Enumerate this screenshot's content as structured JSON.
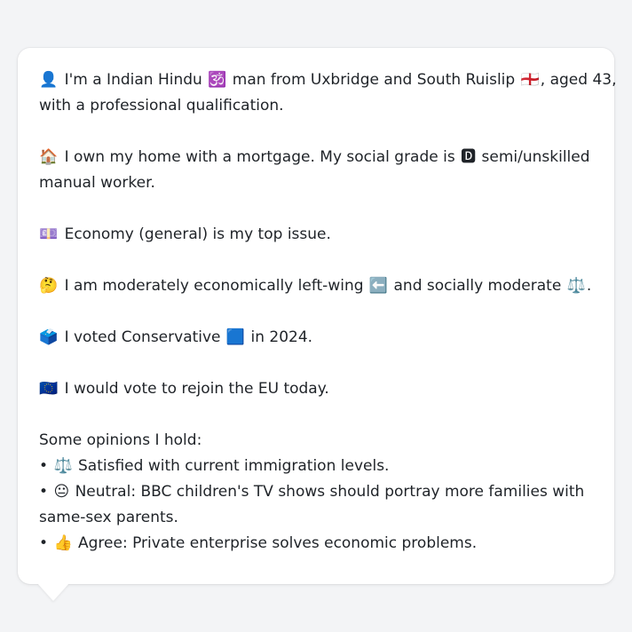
{
  "profile": {
    "identity": {
      "icon": "👤",
      "line1_a": "I'm a Indian Hindu",
      "hindu_icon": "🕉️",
      "line1_b": "man from Uxbridge and South Ruislip",
      "flag_icon": "🏴󠁧󠁢󠁥󠁮󠁧󠁿",
      "line1_c": ", aged 43,",
      "line2": "with a professional qualification."
    },
    "home": {
      "icon": "🏠",
      "line1_a": "I own my home with a mortgage. My social grade is",
      "grade_icon": "🅳",
      "line1_b": "semi/unskilled",
      "line2": "manual worker."
    },
    "issue": {
      "icon": "💷",
      "text": "Economy (general) is my top issue."
    },
    "ideology": {
      "icon": "🤔",
      "text_a": "I am moderately economically left-wing",
      "left_icon": "⬅️",
      "text_b": "and socially moderate",
      "scale_icon": "⚖️",
      "text_c": "."
    },
    "vote": {
      "icon": "🗳️",
      "text_a": "I voted Conservative",
      "party_icon": "🟦",
      "text_b": "in 2024."
    },
    "eu": {
      "icon": "🇪🇺",
      "text": "I would vote to rejoin the EU today."
    },
    "opinions": {
      "heading": "Some opinions I hold:",
      "bullet": "•",
      "items": [
        {
          "icon": "⚖️",
          "line1": "Satisfied with current immigration levels.",
          "line2": ""
        },
        {
          "icon": "😐",
          "line1": "Neutral: BBC children's TV shows should portray more families with",
          "line2": "same-sex parents."
        },
        {
          "icon": "👍",
          "line1": "Agree: Private enterprise solves economic problems.",
          "line2": ""
        }
      ]
    }
  }
}
